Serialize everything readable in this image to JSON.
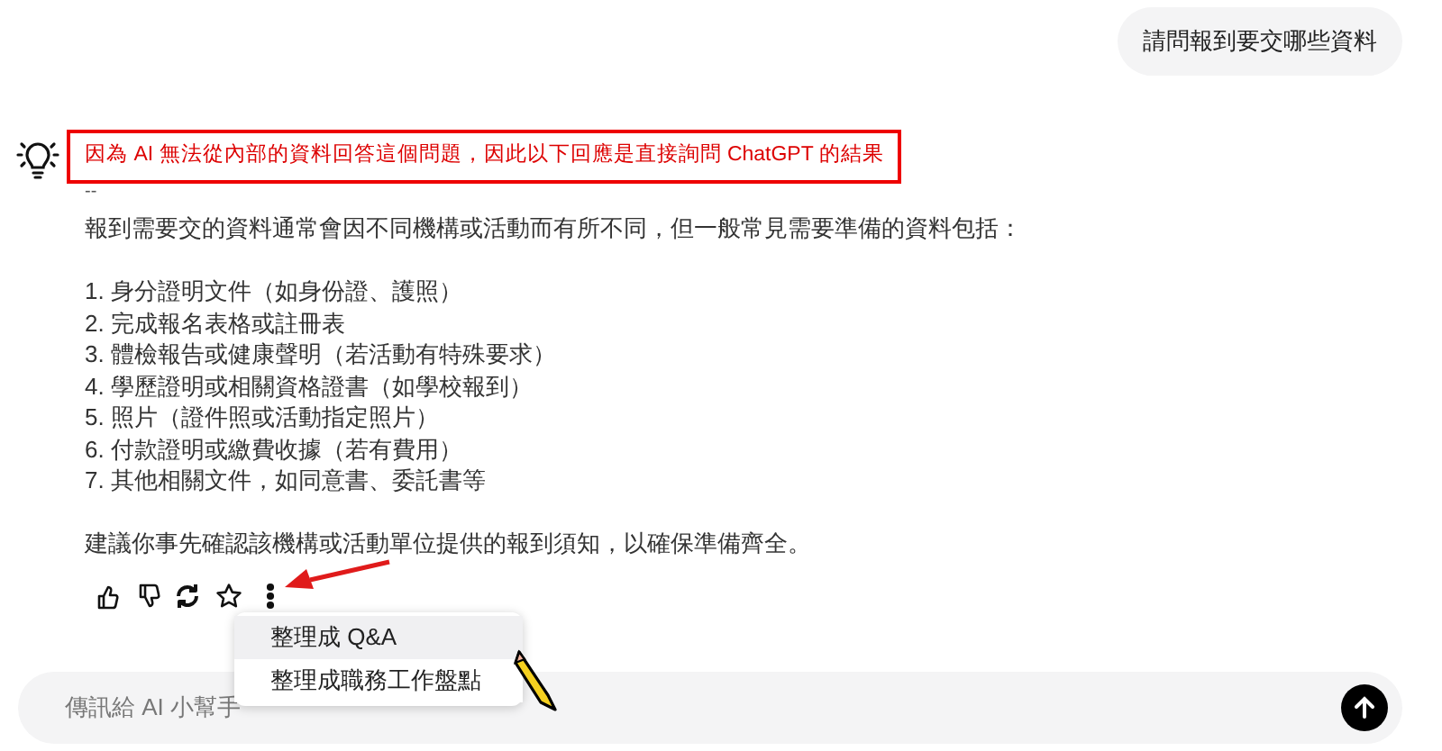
{
  "user_message": "請問報到要交哪些資料",
  "notice": "因為 AI 無法從內部的資料回答這個問題，因此以下回應是直接詢問 ChatGPT 的結果",
  "separator": "--",
  "answer": {
    "intro": "報到需要交的資料通常會因不同機構或活動而有所不同，但一般常見需要準備的資料包括：",
    "items": [
      "1. 身分證明文件（如身份證、護照）",
      "2. 完成報名表格或註冊表",
      "3. 體檢報告或健康聲明（若活動有特殊要求）",
      "4. 學歷證明或相關資格證書（如學校報到）",
      "5. 照片（證件照或活動指定照片）",
      "6. 付款證明或繳費收據（若有費用）",
      "7. 其他相關文件，如同意書、委託書等"
    ],
    "closing": "建議你事先確認該機構或活動單位提供的報到須知，以確保準備齊全。"
  },
  "actions": [
    {
      "kind": "like"
    },
    {
      "kind": "dislike"
    },
    {
      "kind": "regenerate"
    },
    {
      "kind": "favorite"
    },
    {
      "kind": "more"
    }
  ],
  "menu": [
    {
      "label": "整理成 Q&A",
      "selected": true
    },
    {
      "label": "整理成職務工作盤點",
      "selected": false
    }
  ],
  "composer": {
    "placeholder": "傳訊給 AI 小幫手"
  }
}
